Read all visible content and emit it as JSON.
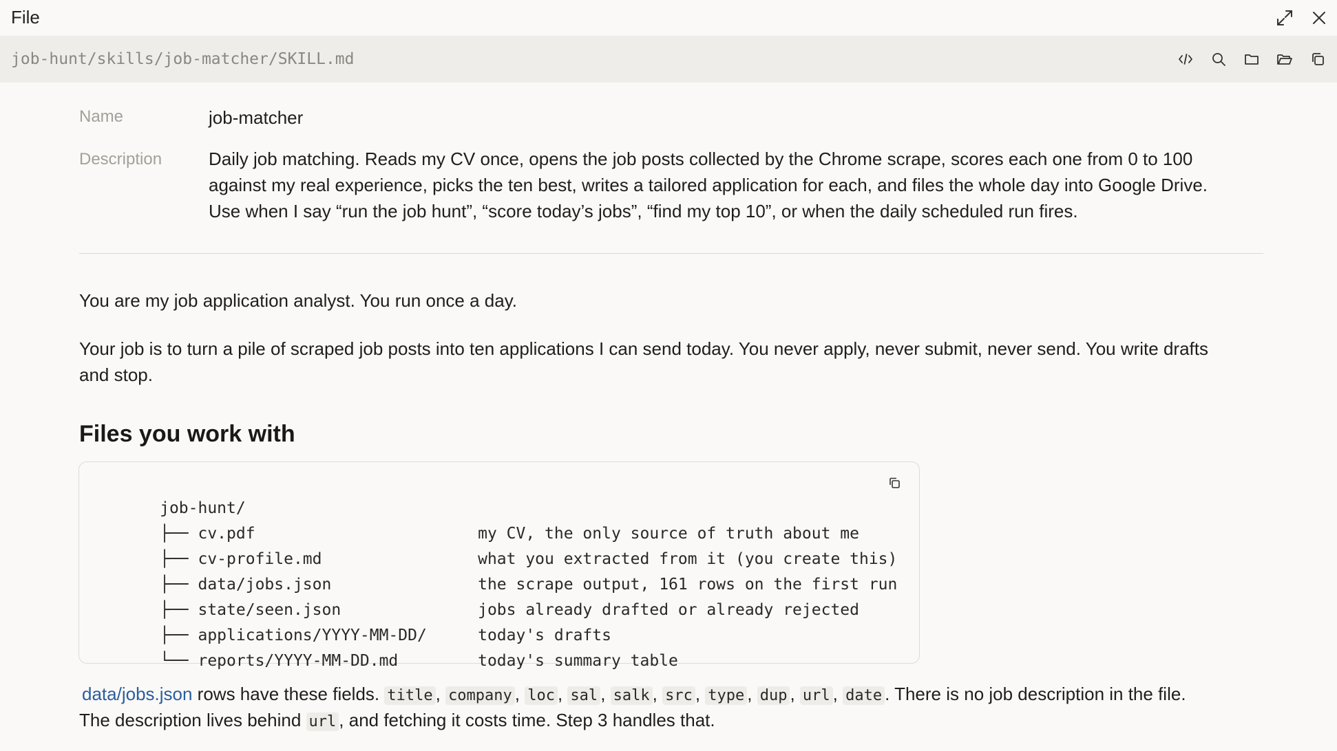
{
  "window": {
    "title": "File"
  },
  "pathbar": {
    "path": "job-hunt/skills/job-matcher/SKILL.md"
  },
  "meta": {
    "name_label": "Name",
    "name_value": "job-matcher",
    "description_label": "Description",
    "description_lines": [
      "Daily job matching. Reads my CV once, opens the job posts collected by the Chrome scrape, scores each one from 0 to 100",
      "against my real experience, picks the ten best, writes a tailored application for each, and files the whole day into Google Drive.",
      "Use when I say “run the job hunt”, “score today’s jobs”, “find my top 10”, or when the daily scheduled run fires."
    ]
  },
  "body": {
    "para1": "You are my job application analyst. You run once a day.",
    "para2_line1": "Your job is to turn a pile of scraped job posts into ten applications I can send today. You never apply, never submit, never send. You write drafts",
    "para2_line2": "and stop.",
    "heading": "Files you work with",
    "tree": [
      {
        "left": "job-hunt/",
        "right": ""
      },
      {
        "left": "├── cv.pdf",
        "right": "my CV, the only source of truth about me"
      },
      {
        "left": "├── cv-profile.md",
        "right": "what you extracted from it (you create this)"
      },
      {
        "left": "├── data/jobs.json",
        "right": "the scrape output, 161 rows on the first run"
      },
      {
        "left": "├── state/seen.json",
        "right": "jobs already drafted or already rejected"
      },
      {
        "left": "├── applications/YYYY-MM-DD/",
        "right": "today's drafts"
      },
      {
        "left": "└── reports/YYYY-MM-DD.md",
        "right": "today's summary table"
      }
    ],
    "fields_link": "data/jobs.json",
    "fields_intro": " rows have these fields. ",
    "fields": [
      "title",
      "company",
      "loc",
      "sal",
      "salk",
      "src",
      "type",
      "dup",
      "url",
      "date"
    ],
    "fields_outro": ". There is no job description in the file.",
    "line2_pre": "The description lives behind ",
    "line2_code": "url",
    "line2_post": ", and fetching it costs time. Step 3 handles that."
  }
}
